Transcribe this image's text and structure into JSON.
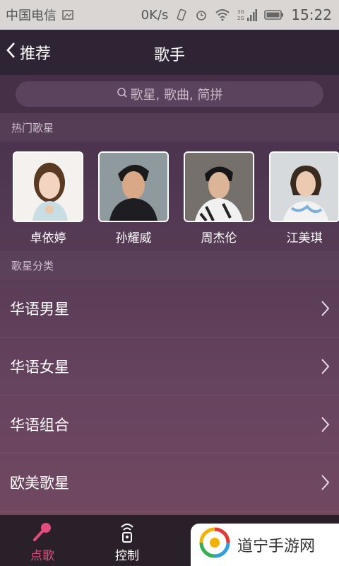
{
  "status_bar": {
    "carrier": "中国电信",
    "speed": "0K/s",
    "network": "3G",
    "network2": "2G",
    "time": "15:22"
  },
  "nav": {
    "back_label": "推荐",
    "title": "歌手"
  },
  "search": {
    "placeholder": "歌星, 歌曲, 简拼"
  },
  "hot_section": {
    "title": "热门歌星",
    "singers": [
      {
        "name": "卓依婷"
      },
      {
        "name": "孙耀威"
      },
      {
        "name": "周杰伦"
      },
      {
        "name": "江美琪"
      }
    ]
  },
  "category_section": {
    "title": "歌星分类",
    "items": [
      {
        "label": "华语男星"
      },
      {
        "label": "华语女星"
      },
      {
        "label": "华语组合"
      },
      {
        "label": "欧美歌星"
      }
    ]
  },
  "tabs": [
    {
      "label": "点歌",
      "icon": "microphone-icon",
      "active": true
    },
    {
      "label": "控制",
      "icon": "remote-icon",
      "active": false
    },
    {
      "label": "",
      "icon": "music-note-icon",
      "active": false
    },
    {
      "label": "",
      "icon": "user-icon",
      "active": false
    }
  ],
  "watermark": {
    "text": "道宁手游网"
  },
  "colors": {
    "accent": "#e24d7e",
    "nav_bg": "#2e2433",
    "status_bg": "#d9d6d4"
  }
}
